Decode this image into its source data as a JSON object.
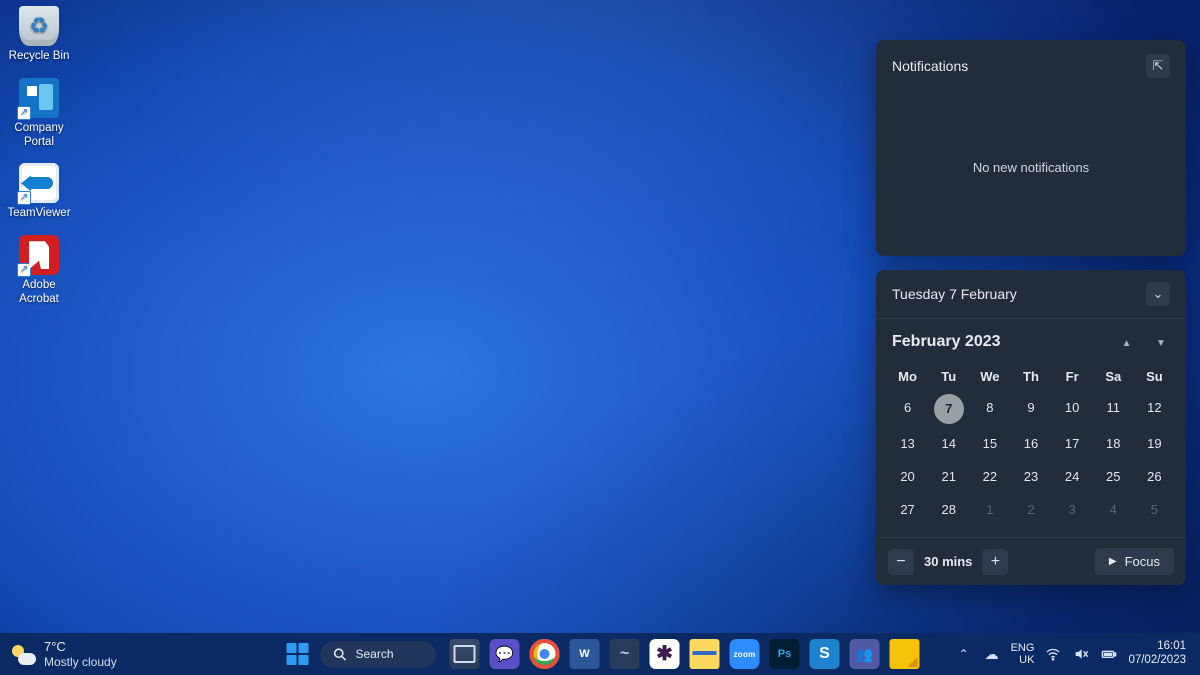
{
  "desktop_icons": [
    {
      "label": "Recycle Bin",
      "name": "recycle-bin",
      "icon": "bin",
      "shortcut": false
    },
    {
      "label": "Company Portal",
      "name": "company-portal",
      "icon": "cp",
      "shortcut": true
    },
    {
      "label": "TeamViewer",
      "name": "teamviewer",
      "icon": "tv",
      "shortcut": true
    },
    {
      "label": "Adobe Acrobat",
      "name": "adobe-acrobat",
      "icon": "ac",
      "shortcut": true
    }
  ],
  "notifications": {
    "title": "Notifications",
    "empty_text": "No new notifications"
  },
  "calendar": {
    "date_header": "Tuesday 7 February",
    "month_label": "February 2023",
    "dow": [
      "Mo",
      "Tu",
      "We",
      "Th",
      "Fr",
      "Sa",
      "Su"
    ],
    "days": [
      {
        "n": 6
      },
      {
        "n": 7,
        "today": true
      },
      {
        "n": 8
      },
      {
        "n": 9
      },
      {
        "n": 10
      },
      {
        "n": 11
      },
      {
        "n": 12
      },
      {
        "n": 13
      },
      {
        "n": 14
      },
      {
        "n": 15
      },
      {
        "n": 16
      },
      {
        "n": 17
      },
      {
        "n": 18
      },
      {
        "n": 19
      },
      {
        "n": 20
      },
      {
        "n": 21
      },
      {
        "n": 22
      },
      {
        "n": 23
      },
      {
        "n": 24
      },
      {
        "n": 25
      },
      {
        "n": 26
      },
      {
        "n": 27
      },
      {
        "n": 28
      },
      {
        "n": 1,
        "other": true
      },
      {
        "n": 2,
        "other": true
      },
      {
        "n": 3,
        "other": true
      },
      {
        "n": 4,
        "other": true
      },
      {
        "n": 5,
        "other": true
      }
    ],
    "focus": {
      "duration_label": "30 mins",
      "button_label": "Focus"
    }
  },
  "taskbar": {
    "weather": {
      "temp": "7°C",
      "condition": "Mostly cloudy"
    },
    "search_label": "Search",
    "pinned": [
      {
        "name": "task-view-button",
        "icon": "taskview"
      },
      {
        "name": "chat-button",
        "icon": "chat"
      },
      {
        "name": "chrome-button",
        "icon": "chrome"
      },
      {
        "name": "word-button",
        "icon": "word",
        "text": "W"
      },
      {
        "name": "app-button",
        "icon": "myst"
      },
      {
        "name": "slack-button",
        "icon": "slack"
      },
      {
        "name": "file-explorer-button",
        "icon": "files"
      },
      {
        "name": "zoom-button",
        "icon": "zoom"
      },
      {
        "name": "photoshop-button",
        "icon": "ps",
        "text": "Ps"
      },
      {
        "name": "snagit-button",
        "icon": "snag"
      },
      {
        "name": "teams-button",
        "icon": "teams"
      },
      {
        "name": "sticky-notes-button",
        "icon": "note"
      }
    ],
    "language": {
      "line1": "ENG",
      "line2": "UK"
    },
    "clock": {
      "time": "16:01",
      "date": "07/02/2023"
    }
  }
}
